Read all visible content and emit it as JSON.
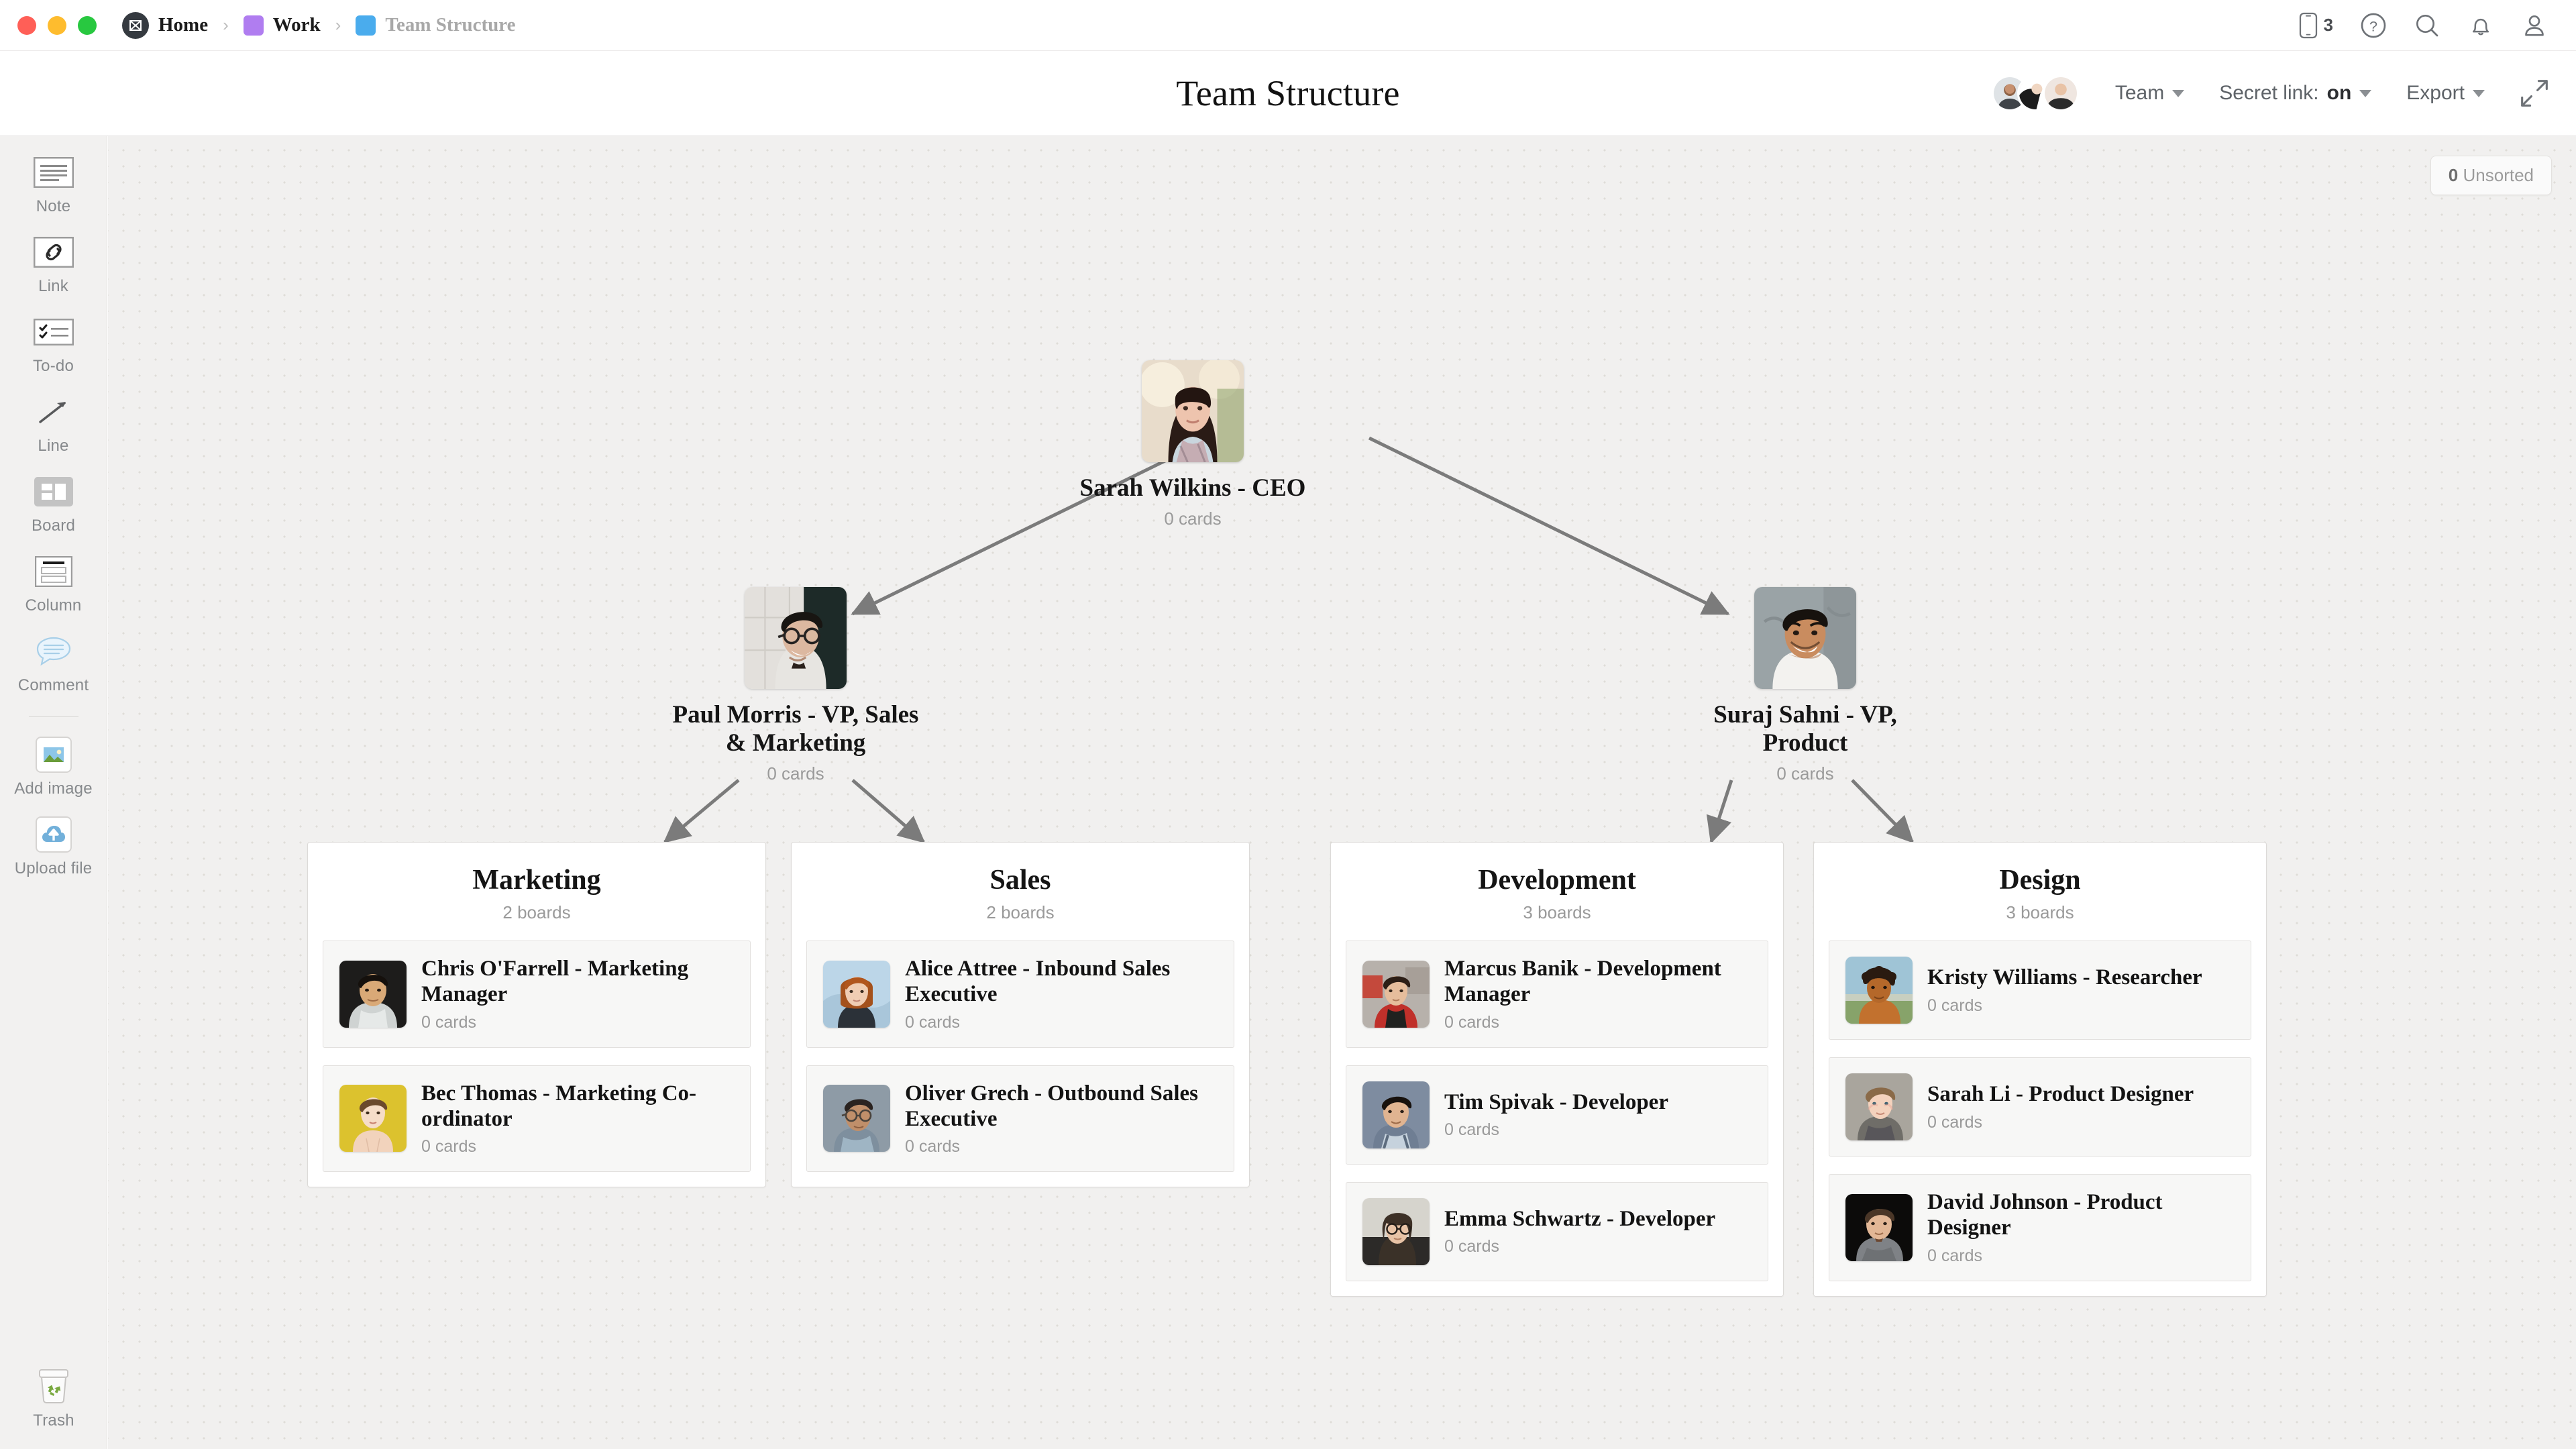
{
  "window": {
    "traffic_lights": [
      "close",
      "minimize",
      "maximize"
    ]
  },
  "breadcrumb": {
    "items": [
      {
        "label": "Home",
        "icon": "milanote-logo-icon",
        "swatch": "",
        "muted": false
      },
      {
        "label": "Work",
        "icon": "color-swatch-icon",
        "swatch": "#b07df0",
        "muted": false
      },
      {
        "label": "Team Structure",
        "icon": "color-swatch-icon",
        "swatch": "#4aaced",
        "muted": true
      }
    ],
    "separator": "›"
  },
  "topbar": {
    "mobile_badge": "3",
    "icons": [
      "mobile-icon",
      "help-icon",
      "search-icon",
      "notifications-icon",
      "account-icon"
    ]
  },
  "header": {
    "title": "Team Structure",
    "team_label": "Team",
    "secret_link_label": "Secret link:",
    "secret_link_value": "on",
    "export_label": "Export",
    "expand_icon": "expand-icon",
    "avatar_count": 3
  },
  "toolbar": {
    "items": [
      {
        "label": "Note",
        "icon": "note-icon"
      },
      {
        "label": "Link",
        "icon": "link-icon"
      },
      {
        "label": "To-do",
        "icon": "todo-icon"
      },
      {
        "label": "Line",
        "icon": "line-arrow-icon"
      },
      {
        "label": "Board",
        "icon": "board-icon"
      },
      {
        "label": "Column",
        "icon": "column-icon"
      },
      {
        "label": "Comment",
        "icon": "comment-icon"
      },
      {
        "label": "Add image",
        "icon": "add-image-icon"
      },
      {
        "label": "Upload file",
        "icon": "upload-file-icon"
      }
    ],
    "trash": {
      "label": "Trash",
      "icon": "trash-icon"
    }
  },
  "canvas": {
    "unsorted_count": "0",
    "unsorted_label": "Unsorted",
    "cards_suffix": "0 cards",
    "colors": {
      "canvas_bg": "#f1f0ef",
      "grid_dot": "#dedcd7",
      "link_line": "#7b7b7b",
      "card_bg": "#f7f7f6",
      "board_bg": "#ffffff"
    }
  },
  "org_chart": {
    "nodes": [
      {
        "id": "ceo",
        "name": "Sarah Wilkins - CEO",
        "cards": "0 cards",
        "photo": "portrait-woman-dark-hair"
      },
      {
        "id": "vp1",
        "name": "Paul Morris - VP, Sales & Marketing",
        "cards": "0 cards",
        "photo": "portrait-man-glasses"
      },
      {
        "id": "vp2",
        "name": "Suraj Sahni - VP, Product",
        "cards": "0 cards",
        "photo": "portrait-man-smiling"
      }
    ],
    "edges": [
      {
        "from": "ceo",
        "to": "vp1"
      },
      {
        "from": "ceo",
        "to": "vp2"
      },
      {
        "from": "vp1",
        "to": "marketing"
      },
      {
        "from": "vp1",
        "to": "sales"
      },
      {
        "from": "vp2",
        "to": "development"
      },
      {
        "from": "vp2",
        "to": "design"
      }
    ]
  },
  "boards": [
    {
      "id": "marketing",
      "title": "Marketing",
      "subtitle": "2 boards",
      "cards": [
        {
          "name": "Chris O'Farrell - Marketing Manager",
          "cards": "0 cards",
          "photo": "portrait-man-dark-bg"
        },
        {
          "name": "Bec Thomas - Marketing Co-ordinator",
          "cards": "0 cards",
          "photo": "portrait-woman-yellow-bg"
        }
      ]
    },
    {
      "id": "sales",
      "title": "Sales",
      "subtitle": "2 boards",
      "cards": [
        {
          "name": "Alice Attree - Inbound Sales Executive",
          "cards": "0 cards",
          "photo": "portrait-woman-red-hair"
        },
        {
          "name": "Oliver Grech - Outbound Sales Executive",
          "cards": "0 cards",
          "photo": "portrait-man-glasses-grey"
        }
      ]
    },
    {
      "id": "development",
      "title": "Development",
      "subtitle": "3 boards",
      "cards": [
        {
          "name": "Marcus Banik - Development Manager",
          "cards": "0 cards",
          "photo": "portrait-man-red-jacket"
        },
        {
          "name": "Tim Spivak - Developer",
          "cards": "0 cards",
          "photo": "portrait-man-blue-bg"
        },
        {
          "name": "Emma Schwartz - Developer",
          "cards": "0 cards",
          "photo": "portrait-woman-glasses"
        }
      ]
    },
    {
      "id": "design",
      "title": "Design",
      "subtitle": "3 boards",
      "cards": [
        {
          "name": "Kristy Williams - Researcher",
          "cards": "0 cards",
          "photo": "portrait-woman-curly-hair"
        },
        {
          "name": "Sarah Li - Product Designer",
          "cards": "0 cards",
          "photo": "portrait-woman-blonde"
        },
        {
          "name": "David Johnson - Product Designer",
          "cards": "0 cards",
          "photo": "portrait-man-dark-bg-2"
        }
      ]
    }
  ]
}
